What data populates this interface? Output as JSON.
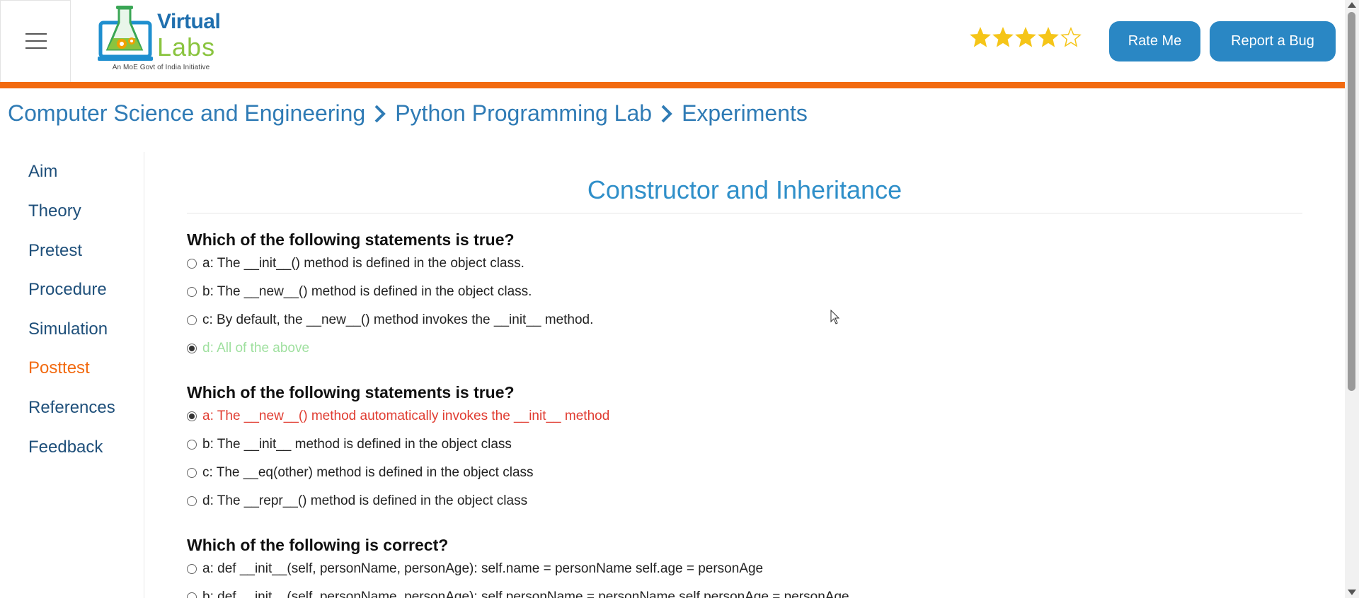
{
  "header": {
    "menu_icon": "hamburger-menu-icon",
    "logo": {
      "line1": "Virtual",
      "line2": "Labs",
      "tagline": "An MoE Govt of India Initiative"
    },
    "rating": {
      "value": 4,
      "max": 5,
      "filled_color": "#f5c518"
    },
    "rate_button": "Rate Me",
    "bug_button": "Report a Bug",
    "accent_color": "#f26a10",
    "button_color": "#2a87c4"
  },
  "breadcrumb": {
    "items": [
      "Computer Science and Engineering",
      "Python Programming Lab",
      "Experiments"
    ]
  },
  "sidebar": {
    "items": [
      {
        "label": "Aim",
        "active": false
      },
      {
        "label": "Theory",
        "active": false
      },
      {
        "label": "Pretest",
        "active": false
      },
      {
        "label": "Procedure",
        "active": false
      },
      {
        "label": "Simulation",
        "active": false
      },
      {
        "label": "Posttest",
        "active": true
      },
      {
        "label": "References",
        "active": false
      },
      {
        "label": "Feedback",
        "active": false
      }
    ]
  },
  "main": {
    "title": "Constructor and Inheritance",
    "questions": [
      {
        "text": "Which of the following statements is true?",
        "options": [
          {
            "label": "a: The __init__() method is defined in the object class.",
            "checked": false,
            "state": "normal"
          },
          {
            "label": "b: The __new__() method is defined in the object class.",
            "checked": false,
            "state": "normal"
          },
          {
            "label": "c: By default, the __new__() method invokes the __init__ method.",
            "checked": false,
            "state": "normal"
          },
          {
            "label": "d: All of the above",
            "checked": true,
            "state": "correct"
          }
        ]
      },
      {
        "text": "Which of the following statements is true?",
        "options": [
          {
            "label": "a: The __new__() method automatically invokes the __init__ method",
            "checked": true,
            "state": "wrong"
          },
          {
            "label": "b: The __init__ method is defined in the object class",
            "checked": false,
            "state": "normal"
          },
          {
            "label": "c: The __eq(other) method is defined in the object class",
            "checked": false,
            "state": "normal"
          },
          {
            "label": "d: The __repr__() method is defined in the object class",
            "checked": false,
            "state": "normal"
          }
        ]
      },
      {
        "text": "Which of the following is correct?",
        "options": [
          {
            "label": "a: def __init__(self, personName, personAge): self.name = personName self.age = personAge",
            "checked": false,
            "state": "normal"
          },
          {
            "label": "b: def __init__(self, personName, personAge): self.personName = personName self.personAge = personAge",
            "checked": false,
            "state": "normal"
          }
        ]
      }
    ]
  }
}
